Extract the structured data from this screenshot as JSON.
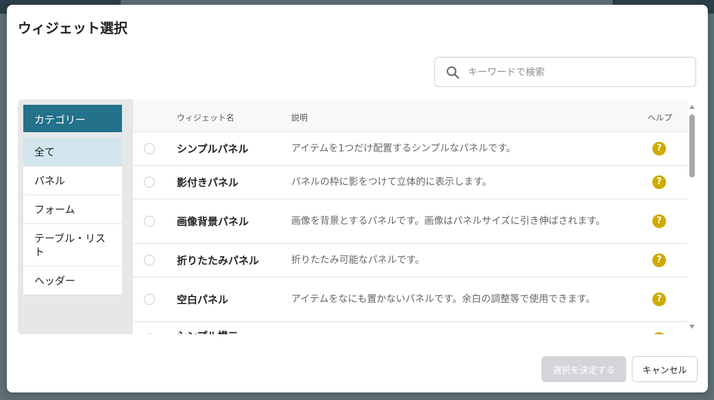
{
  "dialog": {
    "title": "ウィジェット選択"
  },
  "search": {
    "placeholder": "キーワードで検索"
  },
  "categories": {
    "header": "カテゴリー",
    "items": [
      {
        "label": "全て",
        "active": true
      },
      {
        "label": "パネル"
      },
      {
        "label": "フォーム"
      },
      {
        "label": "テーブル・リスト"
      },
      {
        "label": "ヘッダー"
      }
    ]
  },
  "table": {
    "columns": {
      "name": "ウィジェット名",
      "desc": "説明",
      "help": "ヘルプ"
    },
    "rows": [
      {
        "name": "シンプルパネル",
        "desc": "アイテムを1つだけ配置するシンプルなパネルです。"
      },
      {
        "name": "影付きパネル",
        "desc": "パネルの枠に影をつけて立体的に表示します。"
      },
      {
        "name": "画像背景パネル",
        "desc": "画像を背景とするパネルです。画像はパネルサイズに引き伸ばされます。"
      },
      {
        "name": "折りたたみパネル",
        "desc": "折りたたみ可能なパネルです。"
      },
      {
        "name": "空白パネル",
        "desc": "アイテムをなにも置かないパネルです。余白の調整等で使用できます。"
      },
      {
        "name": "シンプル横二",
        "desc": ""
      }
    ],
    "help_glyph": "?"
  },
  "footer": {
    "confirm_label": "選択を決定する",
    "cancel_label": "キャンセル"
  },
  "colors": {
    "accent": "#23718a",
    "help": "#cfaa00",
    "category_active": "#d3e6ee"
  }
}
